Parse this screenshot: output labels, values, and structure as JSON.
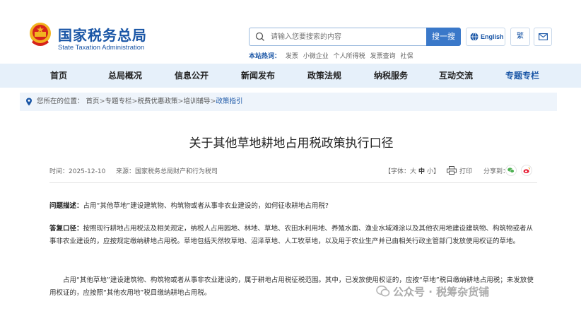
{
  "header": {
    "logo_cn": "国家税务总局",
    "logo_en": "State Taxation Administration",
    "search_placeholder": "请输入您要搜索的内容",
    "search_button": "搜一搜",
    "lang_button": "English",
    "trad_button": "繁",
    "hot_label": "本站热词：",
    "hot_words": [
      "发票",
      "小微企业",
      "个人所得税",
      "发票查询",
      "社保"
    ]
  },
  "nav": {
    "items": [
      "首页",
      "总局概况",
      "信息公开",
      "新闻发布",
      "政策法规",
      "纳税服务",
      "互动交流",
      "专题专栏"
    ]
  },
  "breadcrumb": {
    "prefix": "您所在的位置：",
    "items": [
      "首页",
      "专题专栏",
      "税费优惠政策",
      "培训辅导",
      "政策指引"
    ],
    "separator": ">"
  },
  "article": {
    "title": "关于其他草地耕地占用税政策执行口径",
    "time": "时间：2025-12-10",
    "source": "来源：国家税务总局财产和行为税司",
    "font_size_prefix": "【字体：",
    "font_size_options": [
      "大",
      "中",
      "小"
    ],
    "font_size_suffix": "】",
    "print_label": "打印",
    "share_label": "分享到：",
    "q_label": "问题描述：",
    "q_text": "占用“其他草地”建设建筑物、构筑物或者从事非农业建设的，如何征收耕地占用税?",
    "a_label": "答复口径：",
    "a_text": "按照现行耕地占用税法及相关规定，纳税人占用园地、林地、草地、农田水利用地、养殖水面、渔业水域滩涂以及其他农用地建设建筑物、构筑物或者从事非农业建设的，应按规定缴纳耕地占用税。草地包括天然牧草地、沼泽草地、人工牧草地，以及用于农业生产并已由相关行政主管部门发放使用权证的草地。",
    "p3_text": "占用“其他草地”建设建筑物、构筑物或者从事非农业建设的，属于耕地占用税征税范围。其中，已发放使用权证的，应按“草地”税目缴纳耕地占用税；未发放使用权证的，应按照“其他农用地”税目缴纳耕地占用税。"
  },
  "watermark": "公众号 · 税筹杂货铺",
  "colors": {
    "brand": "#1a56a6",
    "search_button": "#3a78c9",
    "nav_bg": "#e6f0fa",
    "emblem_red": "#d6231b",
    "emblem_gold": "#f2b320"
  }
}
